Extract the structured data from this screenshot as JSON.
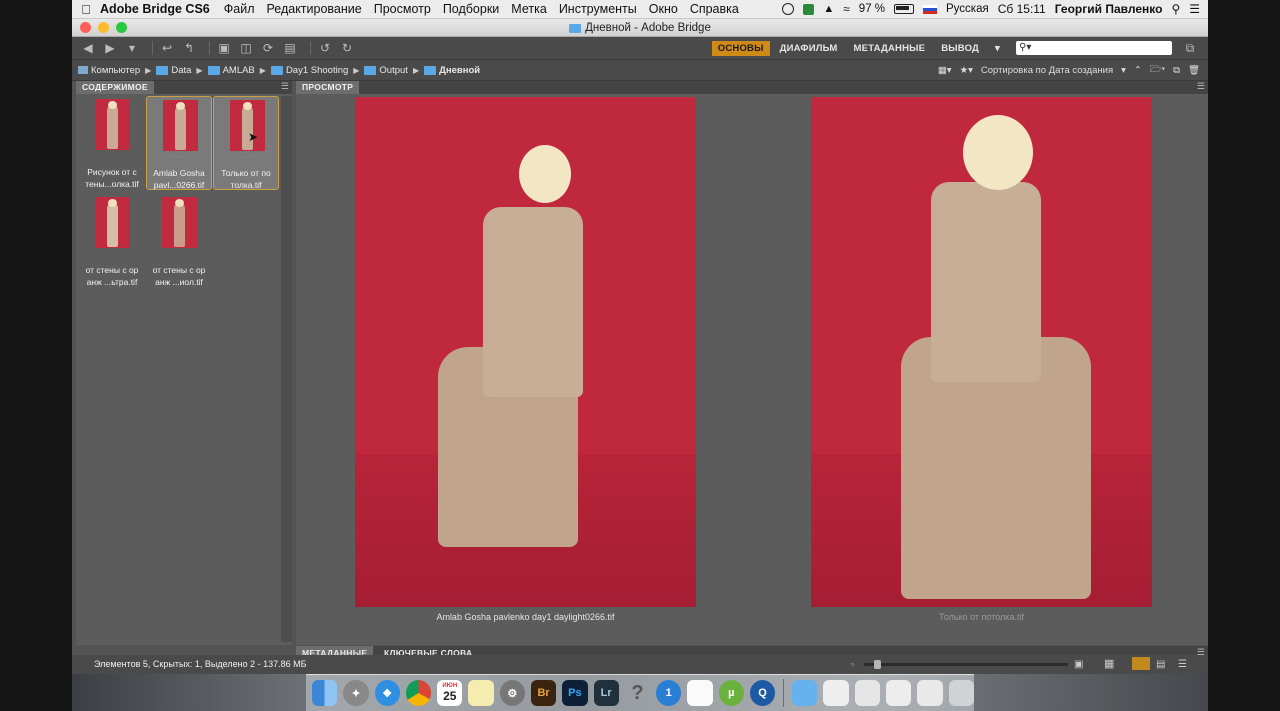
{
  "menubar": {
    "app_name": "Adobe Bridge CS6",
    "items": [
      "Файл",
      "Редактирование",
      "Просмотр",
      "Подборки",
      "Метка",
      "Инструменты",
      "Окно",
      "Справка"
    ],
    "battery": "97 %",
    "input_language": "Русская",
    "clock": "Сб 15:11",
    "user": "Георгий Павленко"
  },
  "window": {
    "title": "Дневной - Adobe Bridge"
  },
  "workspaces": {
    "tabs": [
      "ОСНОВЫ",
      "ДИАФИЛЬМ",
      "МЕТАДАННЫЕ",
      "ВЫВОД"
    ],
    "active": "ОСНОВЫ",
    "search_placeholder": ""
  },
  "path": {
    "crumbs": [
      "Компьютер",
      "Data",
      "AMLAB",
      "Day1 Shooting",
      "Output",
      "Дневной"
    ]
  },
  "sort": {
    "label": "Сортировка по Дата создания"
  },
  "content_panel": {
    "tab_label": "СОДЕРЖИМОЕ",
    "items": [
      {
        "line1": "Рисунок от с",
        "line2": "тены...олка.tif",
        "selected": false
      },
      {
        "line1": "Amlab Gosha",
        "line2": "pavl...0266.tif",
        "selected": true
      },
      {
        "line1": "Только от по",
        "line2": "толка.tif",
        "selected": true
      },
      {
        "line1": "от стены с ор",
        "line2": "анж ...ьтра.tif",
        "selected": false
      },
      {
        "line1": "от стены с ор",
        "line2": "анж ...иол.tif",
        "selected": false
      }
    ]
  },
  "preview_panel": {
    "tab_label": "ПРОСМОТР",
    "left_caption": "Amlab Gosha pavlenko day1 daylight0266.tif",
    "right_caption": "Только от потолка.tif"
  },
  "bottom_tabs": {
    "metadata": "МЕТАДАННЫЕ",
    "keywords": "КЛЮЧЕВЫЕ СЛОВА"
  },
  "status": {
    "text": "Элементов 5, Скрытых: 1, Выделено 2 - 137.86 МБ",
    "thumbnail_size_fraction": 0.05
  },
  "dock": {
    "apps": [
      "Finder",
      "Launchpad",
      "Safari",
      "Chrome",
      "Calendar",
      "Notes",
      "System Preferences",
      "Bridge",
      "Photoshop",
      "Lightroom",
      "Help",
      "1Password",
      "TextEdit",
      "uTorrent",
      "QuickTime"
    ],
    "calendar_day": "25",
    "calendar_month": "ИЮН"
  }
}
